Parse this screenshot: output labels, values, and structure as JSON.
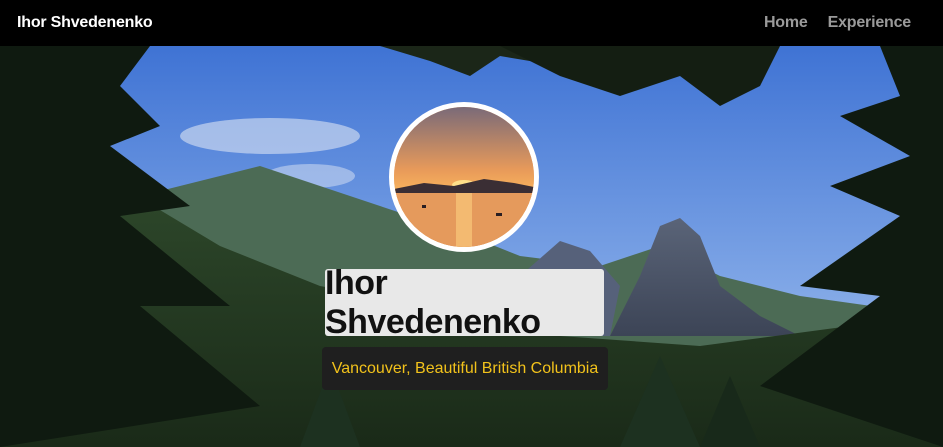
{
  "navbar": {
    "brand": "Ihor Shvedenenko",
    "links": [
      {
        "label": "Home"
      },
      {
        "label": "Experience"
      }
    ]
  },
  "hero": {
    "name": "Ihor Shvedenenko",
    "location": "Vancouver, Beautiful British Columbia"
  },
  "colors": {
    "navbar_bg": "#000000",
    "nav_link": "#9a9a9a",
    "location_text": "#f2c21b",
    "location_bg": "#1f1f1f",
    "name_bg": "#e8e8e8"
  }
}
